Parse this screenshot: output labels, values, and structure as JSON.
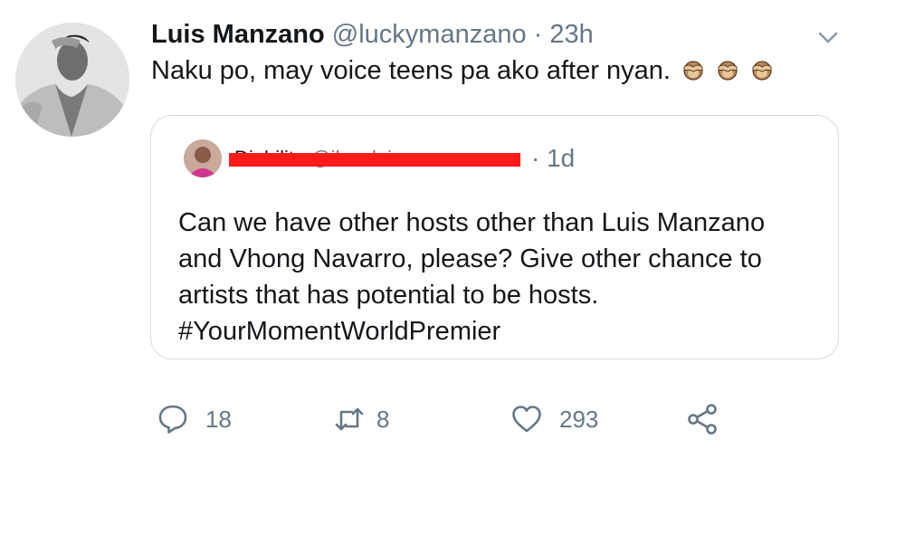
{
  "tweet": {
    "author_name": "Luis Manzano",
    "handle": "@luckymanzano",
    "separator": "·",
    "time": "23h",
    "text": "Naku po, may voice teens pa ako after nyan.",
    "emoji": [
      "see-no-evil-monkey",
      "see-no-evil-monkey",
      "see-no-evil-monkey"
    ]
  },
  "quoted": {
    "author_name": "Diabilita",
    "handle": "@iloveluismanzan",
    "separator": "·",
    "time": "1d",
    "name_redacted": true,
    "text": "Can we have other hosts other than Luis Manzano and Vhong Navarro, please? Give other chance to artists that has potential to be hosts. #YourMomentWorldPremier"
  },
  "actions": {
    "reply_count": "18",
    "retweet_count": "8",
    "like_count": "293"
  },
  "colors": {
    "text": "#14171a",
    "secondary": "#657786",
    "border": "#d6dde3",
    "redaction": "#ff1a1a"
  }
}
